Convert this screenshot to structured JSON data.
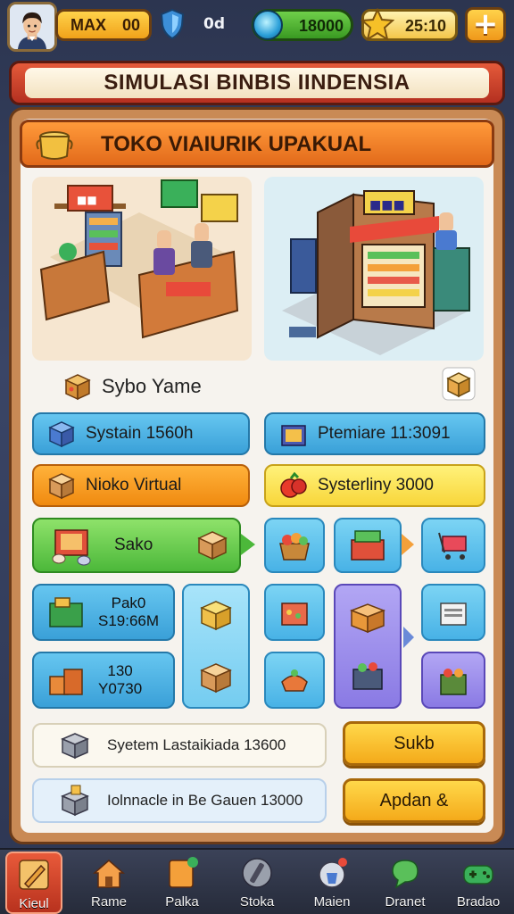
{
  "topbar": {
    "player_name": "MAX",
    "player_level": "00",
    "shield_value": "0d",
    "money": "18000",
    "stars": "25:10",
    "plus_label": "+"
  },
  "title": "SIMULASI BINBIS IINDENSIA",
  "shop_header": "TOKO VIAIURIK UPAKUAL",
  "labels": {
    "sybo": "Sybo Yame"
  },
  "buttons": {
    "system": "Systain 1560h",
    "premium": "Ptemiare 11:3091",
    "nioko": "Nioko Virtual",
    "systeminy": "Systerliny 3000",
    "sako": "Sako",
    "pako_line1": "Pak0",
    "pako_line2": "S19:66M",
    "v130_line1": "130",
    "v130_line2": "Y0730"
  },
  "info": {
    "system_bar": "Syetem Lastaikiada 13600",
    "ionna_bar": "Iolnnacle in Be Gauen 13000"
  },
  "actions": {
    "sukb": "Sukb",
    "apdan": "Apdan &"
  },
  "nav": [
    {
      "label": "Kieul",
      "icon": "pencil-icon"
    },
    {
      "label": "Rame",
      "icon": "house-icon"
    },
    {
      "label": "Palka",
      "icon": "tag-icon"
    },
    {
      "label": "Stoka",
      "icon": "wrench-icon"
    },
    {
      "label": "Maien",
      "icon": "bag-icon"
    },
    {
      "label": "Dranet",
      "icon": "chat-icon"
    },
    {
      "label": "Bradao",
      "icon": "controller-icon"
    }
  ],
  "colors": {
    "header_orange": "#e26a1a",
    "title_red": "#b43020",
    "accent_blue": "#3aa0d8",
    "accent_green": "#4cb83a",
    "accent_gold": "#f4aa1a"
  }
}
